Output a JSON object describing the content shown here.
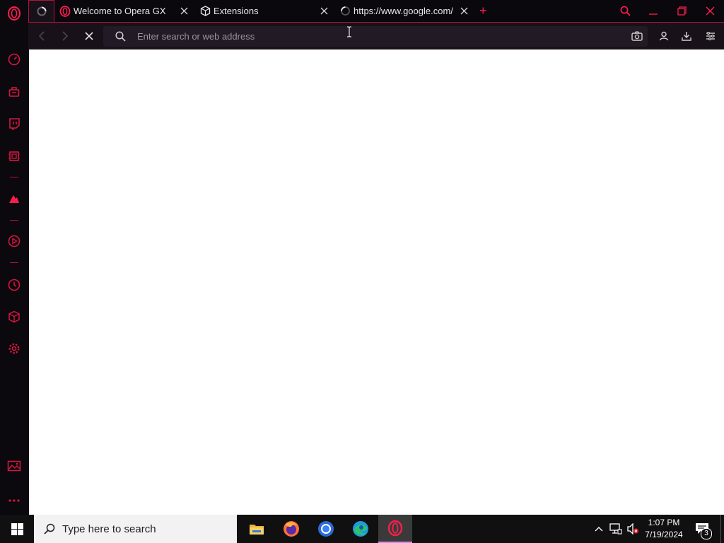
{
  "browser": {
    "tabs": [
      {
        "label": "",
        "active": true,
        "loading": true
      },
      {
        "label": "Welcome to Opera GX",
        "icon": "opera-icon"
      },
      {
        "label": "Extensions",
        "icon": "cube-icon"
      },
      {
        "label": "https://www.google.com/s",
        "icon": "loading-spinner-icon"
      }
    ],
    "new_tab_symbol": "+",
    "address": {
      "placeholder": "Enter search or web address",
      "value": ""
    }
  },
  "sidebar": {
    "items": [
      {
        "name": "opera-logo-icon"
      },
      {
        "name": "gx-control-icon"
      },
      {
        "name": "gx-corner-icon"
      },
      {
        "name": "twitch-icon"
      },
      {
        "name": "cpu-limiter-icon"
      },
      {
        "name": "feather-icon"
      },
      {
        "name": "player-icon"
      },
      {
        "name": "history-icon"
      },
      {
        "name": "extensions-icon"
      },
      {
        "name": "settings-icon"
      },
      {
        "name": "wallpaper-icon"
      },
      {
        "name": "more-icon"
      }
    ]
  },
  "taskbar": {
    "search_placeholder": "Type here to search",
    "time": "1:07 PM",
    "date": "7/19/2024",
    "notification_count": "3",
    "apps": [
      "file-explorer-icon",
      "firefox-icon",
      "chrome-icon",
      "edge-icon",
      "opera-gx-icon"
    ]
  },
  "colors": {
    "accent": "#fa1e4e",
    "sidebar_bg": "#0b080e",
    "toolbar_bg": "#181119",
    "taskbar_bg": "#101010"
  }
}
